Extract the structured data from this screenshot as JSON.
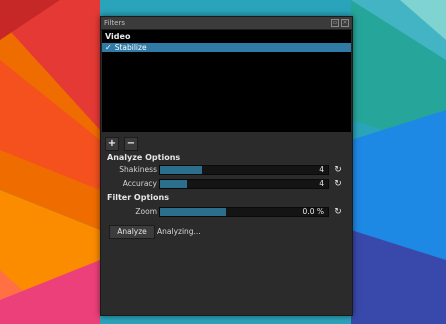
{
  "panel": {
    "title": "Filters",
    "title_buttons": [
      "restore-icon",
      "close-icon"
    ]
  },
  "filter_list": {
    "header": "Video",
    "items": [
      {
        "check": "✓",
        "label": "Stabilize",
        "selected": true
      }
    ]
  },
  "toolbar": {
    "add_label": "+",
    "remove_label": "−"
  },
  "analyze_options": {
    "header": "Analyze Options",
    "shakiness": {
      "label": "Shakiness",
      "value": "4",
      "fill_fraction": 0.25
    },
    "accuracy": {
      "label": "Accuracy",
      "value": "4",
      "fill_fraction": 0.16
    },
    "reset_icon": "↻"
  },
  "filter_options": {
    "header": "Filter Options",
    "zoom": {
      "label": "Zoom",
      "value": "0.0 %",
      "fill_fraction": 0.39
    },
    "reset_icon": "↻"
  },
  "actions": {
    "analyze_label": "Analyze",
    "status": "Analyzing..."
  },
  "colors": {
    "accent": "#2f7ba6",
    "panel_bg": "#2b2b2b",
    "list_bg": "#000000",
    "slider_fill": "#2c6f8c"
  }
}
